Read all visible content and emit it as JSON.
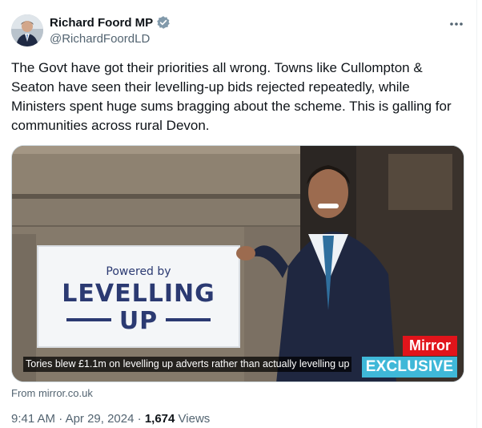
{
  "author": {
    "display_name": "Richard Foord MP",
    "handle": "@RichardFoordLD",
    "verified_icon": "verified-badge-icon"
  },
  "tweet": {
    "text": "The Govt have got their priorities all wrong. Towns like Cullompton & Seaton have seen their levelling-up bids rejected repeatedly, while Ministers spent huge sums bragging about the scheme. This is galling for communities across rural Devon."
  },
  "media": {
    "caption": "Tories blew £1.1m on levelling up adverts rather than actually levelling up",
    "sign_powered": "Powered by",
    "sign_line1": "LEVELLING",
    "sign_line2": "UP",
    "brand_badge": "Mirror",
    "exclusive_badge": "EXCLUSIVE"
  },
  "card_source": "From mirror.co.uk",
  "meta": {
    "time": "9:41 AM",
    "separator": "·",
    "date": "Apr 29, 2024",
    "views_count": "1,674",
    "views_label": "Views"
  },
  "colors": {
    "verified": "#1d9bf0",
    "secondary_text": "#536471",
    "mirror_red": "#e1141b",
    "exclusive_blue": "#3fb8d8",
    "sign_navy": "#2b3a72"
  }
}
